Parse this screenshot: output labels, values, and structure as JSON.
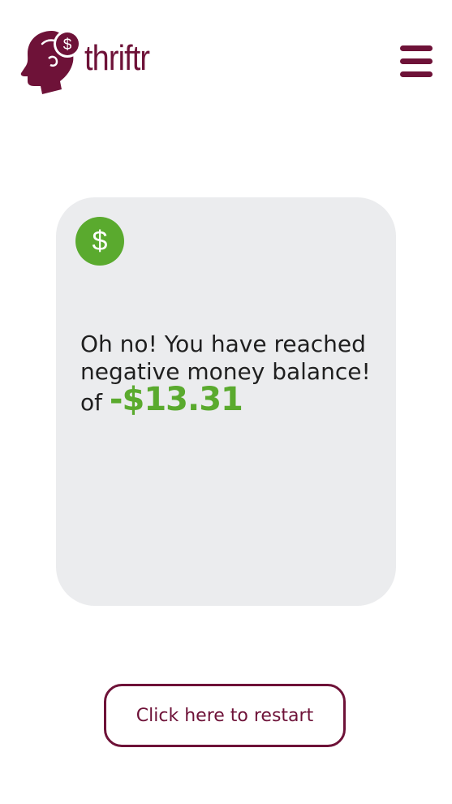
{
  "header": {
    "logo_text": "thriftr",
    "logo_icon": "head-with-dollar-icon",
    "menu_icon": "hamburger-menu-icon"
  },
  "card": {
    "badge_icon": "dollar-icon",
    "badge_symbol": "$",
    "message_line1": "Oh no! You have reached",
    "message_line2": "negative money balance!",
    "message_prefix": "of",
    "amount": "-$13.31"
  },
  "restart": {
    "label": "Click here to restart"
  },
  "colors": {
    "brand": "#6e1238",
    "accent_green": "#5aaa2e",
    "card_bg": "#ebecee"
  }
}
